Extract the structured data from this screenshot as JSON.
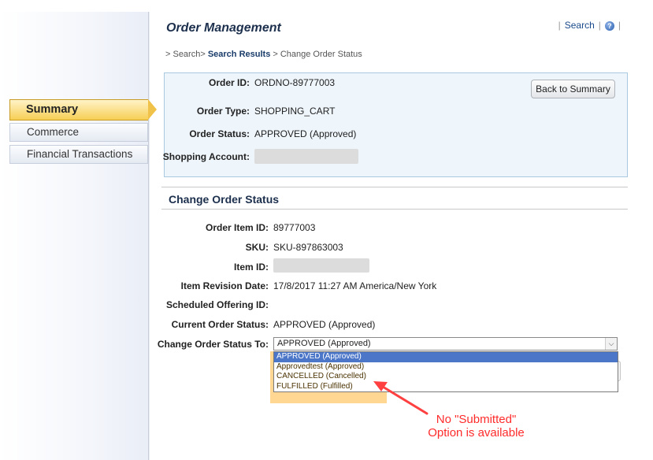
{
  "sidebar": {
    "items": [
      {
        "label": "Summary",
        "active": true
      },
      {
        "label": "Commerce",
        "active": false
      },
      {
        "label": "Financial Transactions",
        "active": false
      }
    ]
  },
  "header": {
    "title": "Order Management",
    "search_link": "Search",
    "help_icon": "question-circle-icon"
  },
  "breadcrumb": {
    "prefix": "> Search> ",
    "current": "Search Results",
    "suffix": " > Change Order Status"
  },
  "summary": {
    "order_id_label": "Order ID:",
    "order_id": "ORDNO-89777003",
    "order_type_label": "Order Type:",
    "order_type": "SHOPPING_CART",
    "order_status_label": "Order Status:",
    "order_status": "APPROVED (Approved)",
    "shopping_account_label": "Shopping Account:",
    "back_button": "Back to Summary"
  },
  "change_status": {
    "section_title": "Change Order Status",
    "order_item_id_label": "Order Item ID:",
    "order_item_id": "89777003",
    "sku_label": "SKU:",
    "sku": "SKU-897863003",
    "item_id_label": "Item ID:",
    "item_revision_date_label": "Item Revision Date:",
    "item_revision_date": "17/8/2017 11:27 AM America/New York",
    "scheduled_offering_id_label": "Scheduled Offering ID:",
    "current_order_status_label": "Current Order Status:",
    "current_order_status": "APPROVED (Approved)",
    "change_to_label": "Change Order Status To:",
    "selected_value": "APPROVED (Approved)",
    "options": [
      "APPROVED (Approved)",
      "Approvedtest (Approved)",
      "CANCELLED (Cancelled)",
      "FULFILLED (Fulfilled)"
    ]
  },
  "annotation": {
    "line1": "No \"Submitted\"",
    "line2": "Option is available",
    "color": "#ff2b2b"
  },
  "colors": {
    "active_nav": "#f7cf55",
    "summary_bg": "#eef5fb",
    "highlight": "#ffce7a",
    "selected_option": "#4c77c9"
  }
}
